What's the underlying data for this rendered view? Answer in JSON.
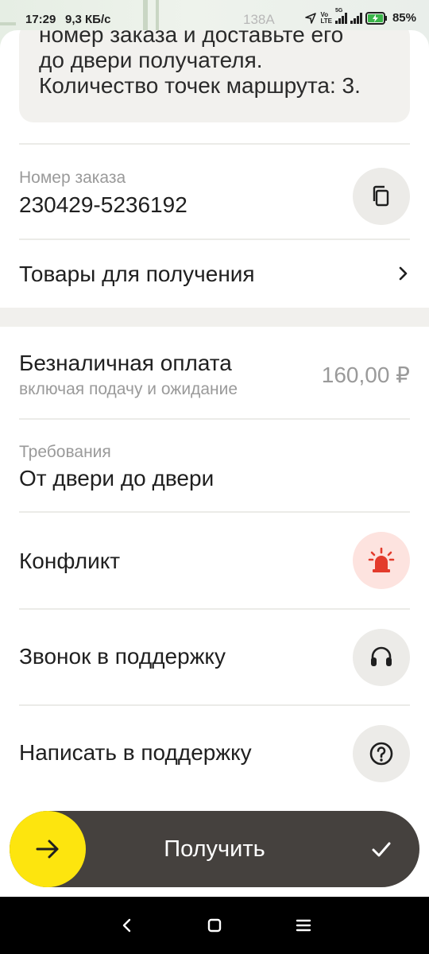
{
  "status_bar": {
    "time": "17:29",
    "speed": "9,3 КБ/с",
    "map_number": "138А",
    "network_top": "Vo",
    "network_bottom": "LTE",
    "network_5g": "5G",
    "battery": "85%"
  },
  "message": {
    "line1": "номер заказа и доставьте его",
    "line2": "до двери получателя.",
    "line3": "Количество точек маршрута: 3."
  },
  "order": {
    "label": "Номер заказа",
    "number": "230429-5236192",
    "copy_icon": "copy-icon"
  },
  "goods": {
    "label": "Товары для получения",
    "icon": "chevron-right-icon"
  },
  "payment": {
    "title": "Безналичная оплата",
    "subtitle": "включая подачу и ожидание",
    "amount": "160,00 ₽"
  },
  "requirements": {
    "label": "Требования",
    "value": "От двери до двери"
  },
  "actions": {
    "conflict_label": "Конфликт",
    "call_support_label": "Звонок в поддержку",
    "write_support_label": "Написать в поддержку"
  },
  "bottom": {
    "receive_label": "Получить"
  },
  "colors": {
    "accent_yellow": "#fde50e",
    "slider_bg": "#45413e",
    "conflict_bg": "#fde3df",
    "conflict_icon": "#e33b2c"
  }
}
